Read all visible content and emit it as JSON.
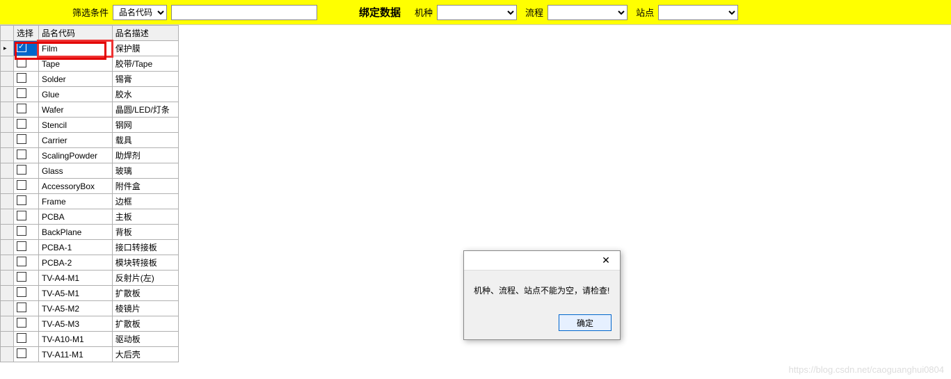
{
  "topbar": {
    "filter_label": "筛选条件",
    "filter_select_value": "品名代码",
    "filter_input_value": "",
    "bind_label": "绑定数据",
    "machine_label": "机种",
    "machine_value": "",
    "process_label": "流程",
    "process_value": "",
    "station_label": "站点",
    "station_value": ""
  },
  "grid": {
    "headers": {
      "select": "选择",
      "code": "品名代码",
      "desc": "品名描述"
    },
    "rows": [
      {
        "selected": true,
        "checked": true,
        "code": "Film",
        "desc": "保护膜"
      },
      {
        "selected": false,
        "checked": false,
        "code": "Tape",
        "desc": "胶带/Tape"
      },
      {
        "selected": false,
        "checked": false,
        "code": "Solder",
        "desc": "锡膏"
      },
      {
        "selected": false,
        "checked": false,
        "code": "Glue",
        "desc": "胶水"
      },
      {
        "selected": false,
        "checked": false,
        "code": "Wafer",
        "desc": "晶圆/LED/灯条"
      },
      {
        "selected": false,
        "checked": false,
        "code": "Stencil",
        "desc": "钢网"
      },
      {
        "selected": false,
        "checked": false,
        "code": "Carrier",
        "desc": "载具"
      },
      {
        "selected": false,
        "checked": false,
        "code": "ScalingPowder",
        "desc": "助焊剂"
      },
      {
        "selected": false,
        "checked": false,
        "code": "Glass",
        "desc": "玻璃"
      },
      {
        "selected": false,
        "checked": false,
        "code": "AccessoryBox",
        "desc": "附件盒"
      },
      {
        "selected": false,
        "checked": false,
        "code": "Frame",
        "desc": "边框"
      },
      {
        "selected": false,
        "checked": false,
        "code": "PCBA",
        "desc": "主板"
      },
      {
        "selected": false,
        "checked": false,
        "code": "BackPlane",
        "desc": "背板"
      },
      {
        "selected": false,
        "checked": false,
        "code": "PCBA-1",
        "desc": "接口转接板"
      },
      {
        "selected": false,
        "checked": false,
        "code": "PCBA-2",
        "desc": "模块转接板"
      },
      {
        "selected": false,
        "checked": false,
        "code": "TV-A4-M1",
        "desc": "反射片(左)"
      },
      {
        "selected": false,
        "checked": false,
        "code": "TV-A5-M1",
        "desc": "扩散板"
      },
      {
        "selected": false,
        "checked": false,
        "code": "TV-A5-M2",
        "desc": "棱镜片"
      },
      {
        "selected": false,
        "checked": false,
        "code": "TV-A5-M3",
        "desc": "扩散板"
      },
      {
        "selected": false,
        "checked": false,
        "code": "TV-A10-M1",
        "desc": "驱动板"
      },
      {
        "selected": false,
        "checked": false,
        "code": "TV-A11-M1",
        "desc": "大后壳"
      }
    ]
  },
  "dialog": {
    "message": "机种、流程、站点不能为空，请检查!",
    "ok_label": "确定"
  },
  "watermark": "https://blog.csdn.net/caoguanghui0804"
}
